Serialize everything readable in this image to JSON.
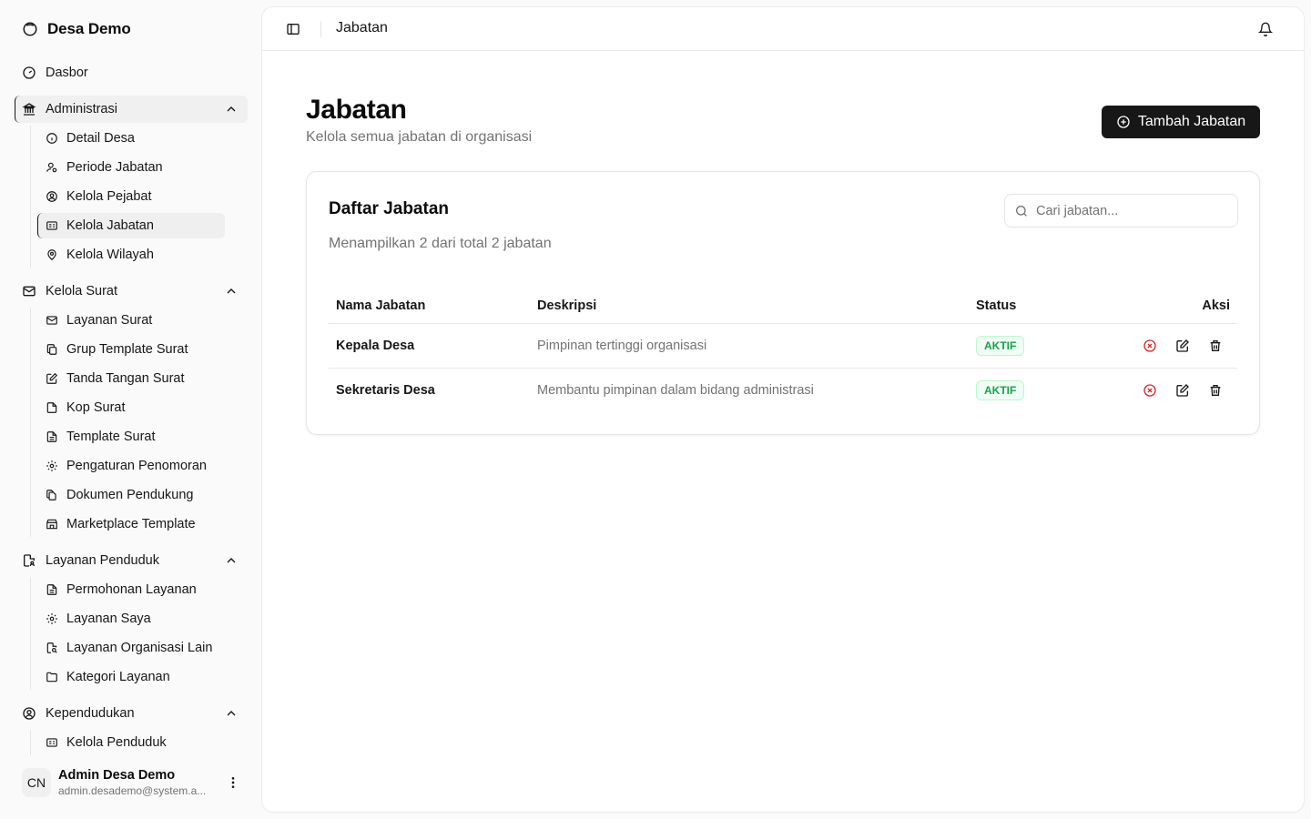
{
  "sidebar": {
    "brand": "Desa Demo",
    "dashboard": "Dasbor",
    "administrasi": {
      "label": "Administrasi",
      "items": [
        "Detail Desa",
        "Periode Jabatan",
        "Kelola Pejabat",
        "Kelola Jabatan",
        "Kelola Wilayah"
      ]
    },
    "kelola_surat": {
      "label": "Kelola Surat",
      "items": [
        "Layanan Surat",
        "Grup Template Surat",
        "Tanda Tangan Surat",
        "Kop Surat",
        "Template Surat",
        "Pengaturan Penomoran",
        "Dokumen Pendukung",
        "Marketplace Template"
      ]
    },
    "layanan_penduduk": {
      "label": "Layanan Penduduk",
      "items": [
        "Permohonan Layanan",
        "Layanan Saya",
        "Layanan Organisasi Lain",
        "Kategori Layanan"
      ]
    },
    "kependudukan": {
      "label": "Kependudukan",
      "items": [
        "Kelola Penduduk"
      ]
    },
    "user": {
      "initials": "CN",
      "name": "Admin Desa Demo",
      "email": "admin.desademo@system.a..."
    }
  },
  "topbar": {
    "title": "Jabatan"
  },
  "page": {
    "title": "Jabatan",
    "subtitle": "Kelola semua jabatan di organisasi",
    "add_button": "Tambah Jabatan"
  },
  "card": {
    "title": "Daftar Jabatan",
    "subtitle": "Menampilkan 2 dari total 2 jabatan",
    "search_placeholder": "Cari jabatan..."
  },
  "table": {
    "columns": [
      "Nama Jabatan",
      "Deskripsi",
      "Status",
      "Aksi"
    ],
    "rows": [
      {
        "name": "Kepala Desa",
        "description": "Pimpinan tertinggi organisasi",
        "status": "AKTIF"
      },
      {
        "name": "Sekretaris Desa",
        "description": "Membantu pimpinan dalam bidang administrasi",
        "status": "AKTIF"
      }
    ]
  },
  "colors": {
    "primary": "#171717",
    "muted": "#737373",
    "success": "#16a34a",
    "danger": "#dc2626"
  }
}
